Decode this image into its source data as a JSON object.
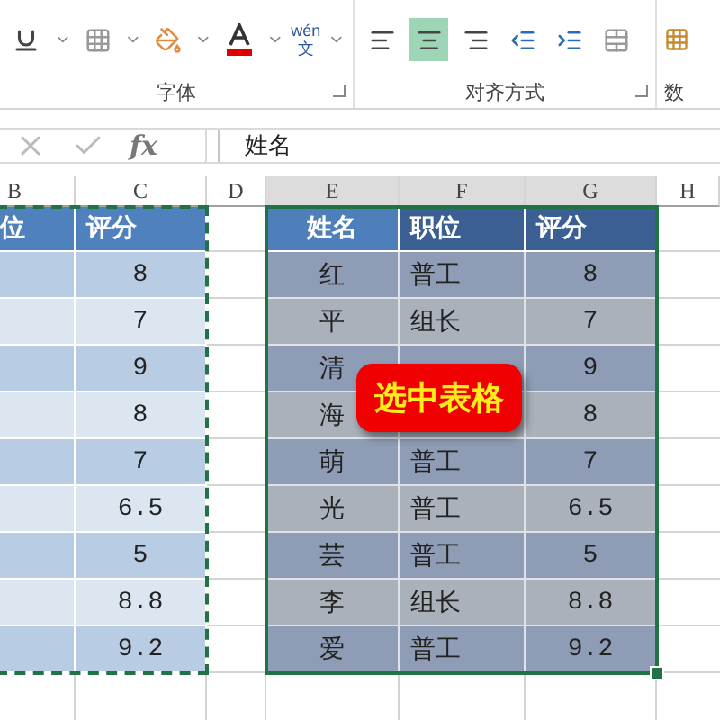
{
  "ribbon": {
    "font_group": {
      "label": "字体",
      "phonetic_label": "wén",
      "phonetic_char": "文"
    },
    "align_group": {
      "label": "对齐方式",
      "buttons": [
        {
          "kind": "left",
          "selected": false
        },
        {
          "kind": "center",
          "selected": true
        },
        {
          "kind": "right",
          "selected": false
        },
        {
          "kind": "indent-decrease",
          "selected": false
        },
        {
          "kind": "indent-increase",
          "selected": false
        }
      ]
    },
    "number_group": {
      "label": "数"
    }
  },
  "formula_bar": {
    "function_label": "fx",
    "value": "姓名"
  },
  "columns": [
    "B",
    "C",
    "D",
    "E",
    "F",
    "G",
    "H"
  ],
  "left_table": {
    "header": [
      "位",
      "评分"
    ],
    "rows": [
      {
        "score": "8"
      },
      {
        "score": "7"
      },
      {
        "score": "9"
      },
      {
        "score": "8"
      },
      {
        "score": "7"
      },
      {
        "score": "6.5"
      },
      {
        "score": "5"
      },
      {
        "score": "8.8"
      },
      {
        "score": "9.2"
      }
    ]
  },
  "right_table": {
    "header": [
      "姓名",
      "职位",
      "评分"
    ],
    "rows": [
      {
        "name": "红",
        "position": "普工",
        "score": "8"
      },
      {
        "name": "平",
        "position": "组长",
        "score": "7"
      },
      {
        "name": "清",
        "score": "9"
      },
      {
        "name": "海",
        "score": "8"
      },
      {
        "name": "萌",
        "position": "普工",
        "score": "7"
      },
      {
        "name": "光",
        "position": "普工",
        "score": "6.5"
      },
      {
        "name": "芸",
        "position": "普工",
        "score": "5"
      },
      {
        "name": "李",
        "position": "组长",
        "score": "8.8"
      },
      {
        "name": "爱",
        "position": "普工",
        "score": "9.2"
      }
    ]
  },
  "callout": "选中表格"
}
